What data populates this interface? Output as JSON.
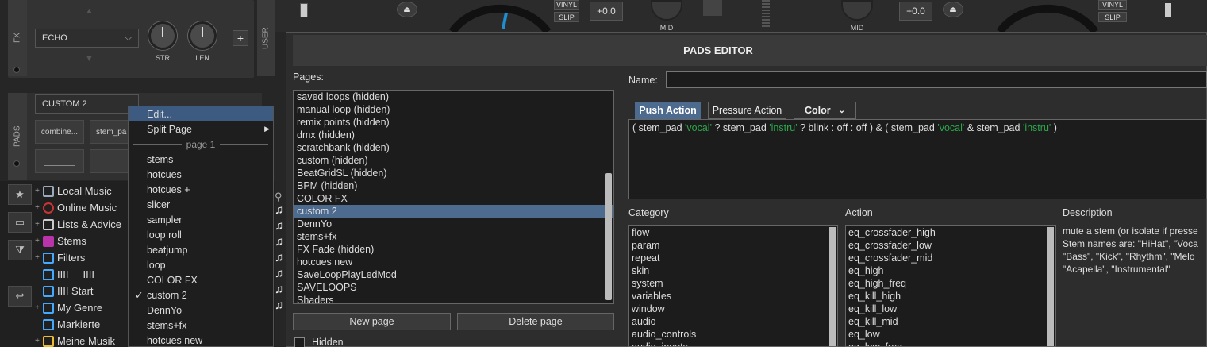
{
  "deck": {
    "fx_label": "FX",
    "fx_select": "ECHO",
    "knob1": "STR",
    "knob2": "LEN",
    "add": "+",
    "user_label": "USER",
    "pads_label": "PADS",
    "pads_select": "CUSTOM 2",
    "pad1": "combine...",
    "pad2": "stem_pa",
    "vinyl": "VINYL",
    "slip": "SLIP",
    "pitch": "+0.0",
    "mid": "MID"
  },
  "tree": {
    "items": [
      {
        "label": "Local Music",
        "icon": "computer-icon",
        "color": "#9ab"
      },
      {
        "label": "Online Music",
        "icon": "globe-icon",
        "color": "#c33"
      },
      {
        "label": "Lists & Advice",
        "icon": "list-icon",
        "color": "#ccc"
      },
      {
        "label": "Stems",
        "icon": "stems-icon",
        "color": "#b3a"
      },
      {
        "label": "Filters",
        "icon": "filter-icon",
        "color": "#4af"
      },
      {
        "label": "IIII     IIII",
        "icon": "filter-icon",
        "color": "#4af"
      },
      {
        "label": "IIII Start",
        "icon": "filter-icon",
        "color": "#4af"
      },
      {
        "label": "My Genre",
        "icon": "filter-icon",
        "color": "#4af"
      },
      {
        "label": "Markierte",
        "icon": "filter-icon",
        "color": "#4af"
      },
      {
        "label": "Meine Musik",
        "icon": "star-icon",
        "color": "#eb3"
      }
    ]
  },
  "context_menu": {
    "edit": "Edit...",
    "split_page": "Split Page",
    "separator": "page 1",
    "items": [
      "stems",
      "hotcues",
      "hotcues +",
      "slicer",
      "sampler",
      "loop roll",
      "beatjump",
      "loop",
      "COLOR FX",
      "custom 2",
      "DennYo",
      "stems+fx",
      "hotcues new"
    ],
    "checked": "custom 2"
  },
  "dialog": {
    "title": "PADS EDITOR",
    "pages_label": "Pages:",
    "pages": [
      "saved loops (hidden)",
      "manual loop (hidden)",
      "remix points (hidden)",
      "dmx (hidden)",
      "scratchbank (hidden)",
      "custom (hidden)",
      "BeatGridSL (hidden)",
      "BPM (hidden)",
      "COLOR FX",
      "custom 2",
      "DennYo",
      "stems+fx",
      "FX Fade (hidden)",
      "hotcues new",
      "SaveLoopPlayLedMod",
      "SAVELOOPS",
      "Shaders"
    ],
    "selected_page": "custom 2",
    "new_page": "New page",
    "delete_page": "Delete page",
    "hidden_label": "Hidden",
    "name_label": "Name:",
    "tabs": {
      "push": "Push Action",
      "pressure": "Pressure Action",
      "color": "Color"
    },
    "script": {
      "p1": "( stem_pad ",
      "s1": "'vocal'",
      "p2": " ? stem_pad ",
      "s2": "'instru'",
      "p3": " ? blink : off : off ) & ( stem_pad ",
      "s3": "'vocal'",
      "p4": " & stem_pad ",
      "s4": "'instru'",
      "p5": " )"
    },
    "category_label": "Category",
    "categories": [
      "flow",
      "param",
      "repeat",
      "skin",
      "system",
      "variables",
      "window",
      "audio",
      "audio_controls",
      "audio_inputs"
    ],
    "action_label": "Action",
    "actions": [
      "eq_crossfader_high",
      "eq_crossfader_low",
      "eq_crossfader_mid",
      "eq_high",
      "eq_high_freq",
      "eq_kill_high",
      "eq_kill_low",
      "eq_kill_mid",
      "eq_low",
      "eq_low_freq"
    ],
    "description_label": "Description",
    "description": "mute a stem (or isolate if presse Stem names are: \"HiHat\", \"Voca \"Bass\", \"Kick\", \"Rhythm\", \"Melo \"Acapella\", \"Instrumental\""
  }
}
